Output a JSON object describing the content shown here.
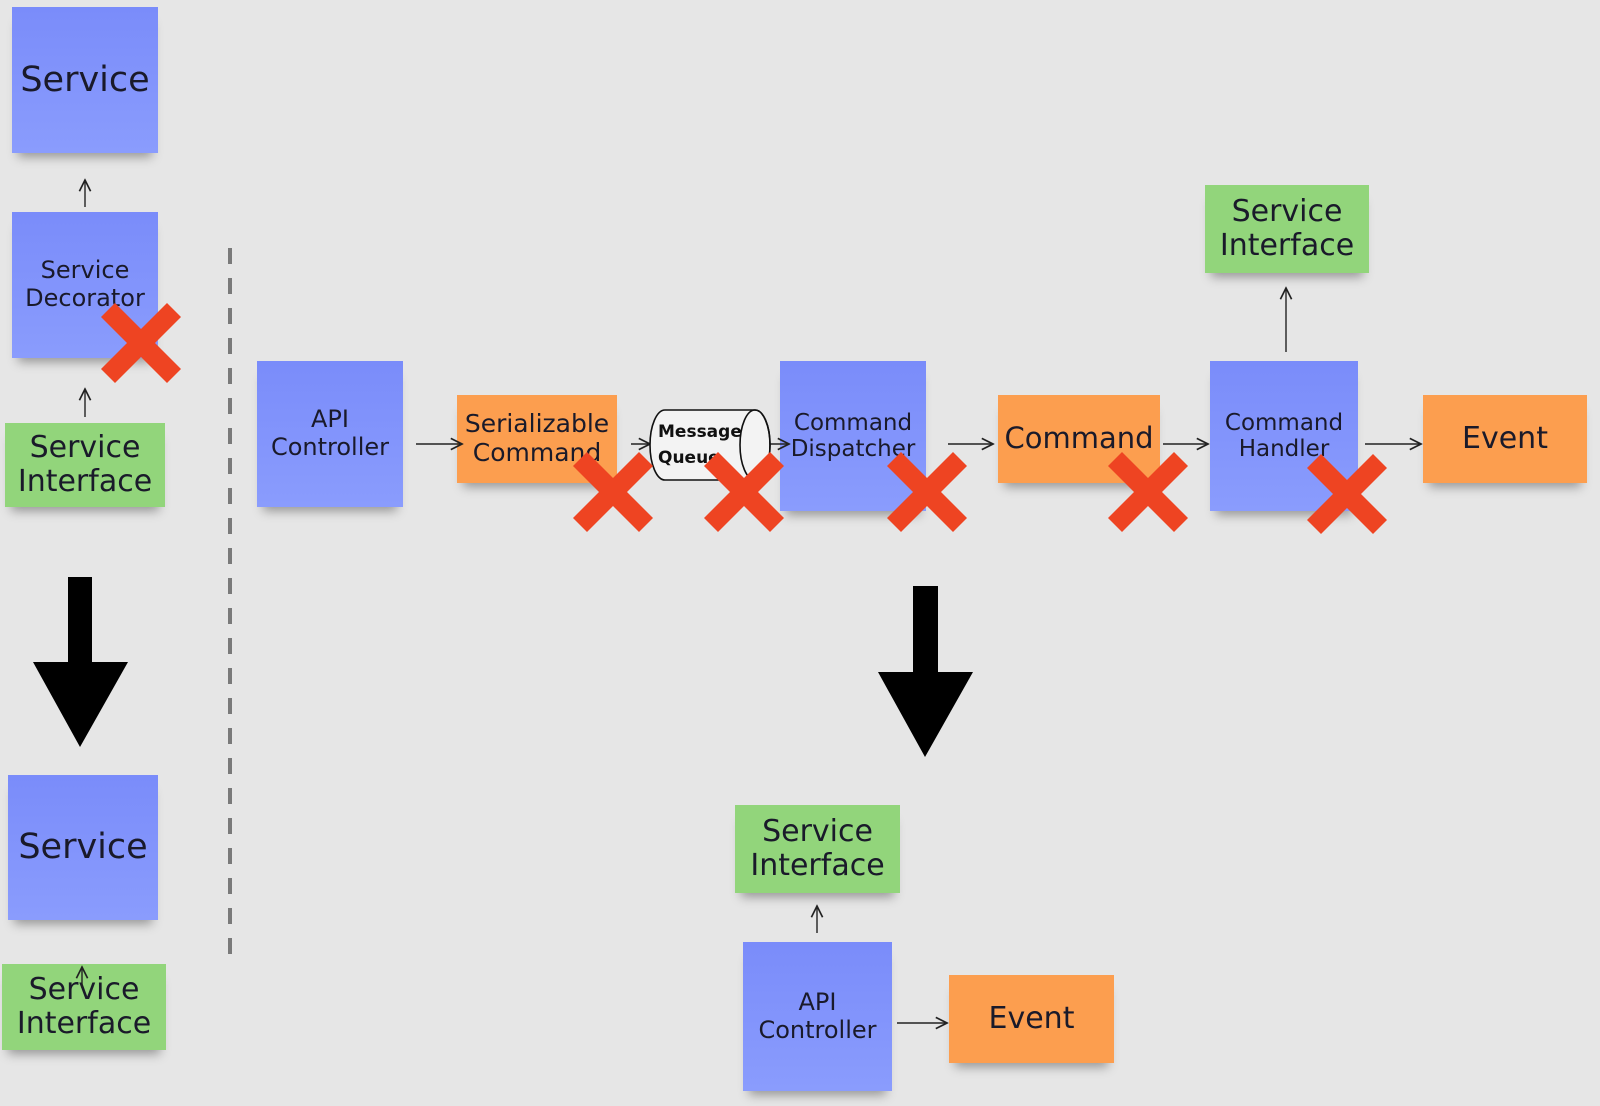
{
  "colors": {
    "service": "#7a8cfa",
    "command": "#fc9e4f",
    "interface": "#92d57b",
    "cross": "#ee4422",
    "background": "#e6e6e6"
  },
  "left": {
    "service_top": "Service",
    "service_decorator": "Service\nDecorator",
    "service_interface_top": "Service\nInterface",
    "service_bottom": "Service",
    "service_interface_bottom": "Service\nInterface"
  },
  "pipeline": {
    "api_controller": "API\nController",
    "serializable_command": "Serializable\nCommand",
    "message_queue": "Message\nQueue",
    "command_dispatcher": "Command\nDispatcher",
    "command": "Command",
    "command_handler": "Command\nHandler",
    "event": "Event",
    "service_interface": "Service\nInterface"
  },
  "result": {
    "service_interface": "Service\nInterface",
    "api_controller": "API\nController",
    "event": "Event"
  }
}
